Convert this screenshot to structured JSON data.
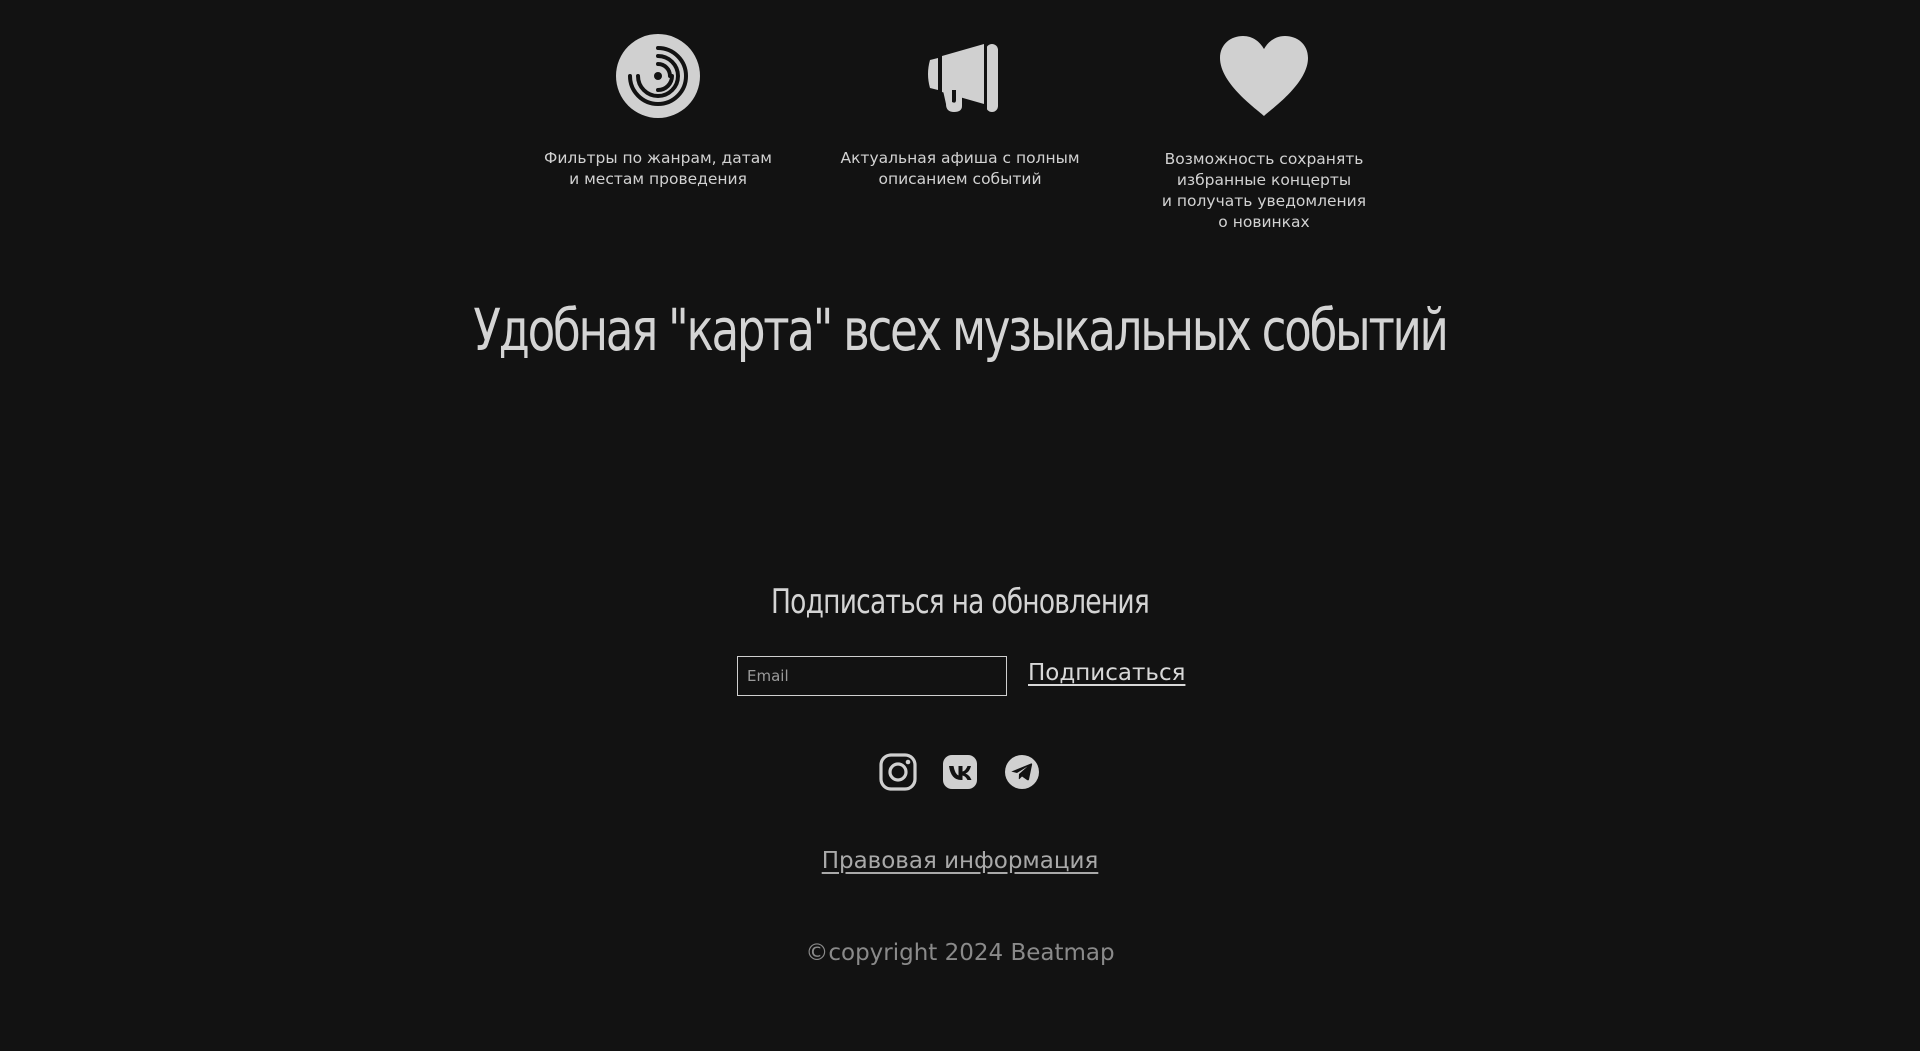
{
  "features": [
    {
      "icon": "vinyl-record-icon",
      "text": "Фильтры по жанрам, датам\nи местам проведения"
    },
    {
      "icon": "megaphone-icon",
      "text": "Актуальная афиша с полным\nописанием событий"
    },
    {
      "icon": "heart-icon",
      "text": "Возможность сохранять\nизбранные концерты\nи получать уведомления\nо новинках"
    }
  ],
  "headline": "Удобная \"карта\" всех музыкальных событий",
  "subscribe": {
    "title": "Подписаться на обновления",
    "email_placeholder": "Email",
    "button_label": "Подписаться"
  },
  "social": [
    {
      "icon": "instagram-icon"
    },
    {
      "icon": "vk-icon"
    },
    {
      "icon": "telegram-icon"
    }
  ],
  "footer": {
    "legal_label": "Правовая информация",
    "copyright": "©copyright 2024 Beatmap"
  },
  "colors": {
    "background": "#121212",
    "icon": "#d0d0d0",
    "text": "#d4d4d4"
  }
}
